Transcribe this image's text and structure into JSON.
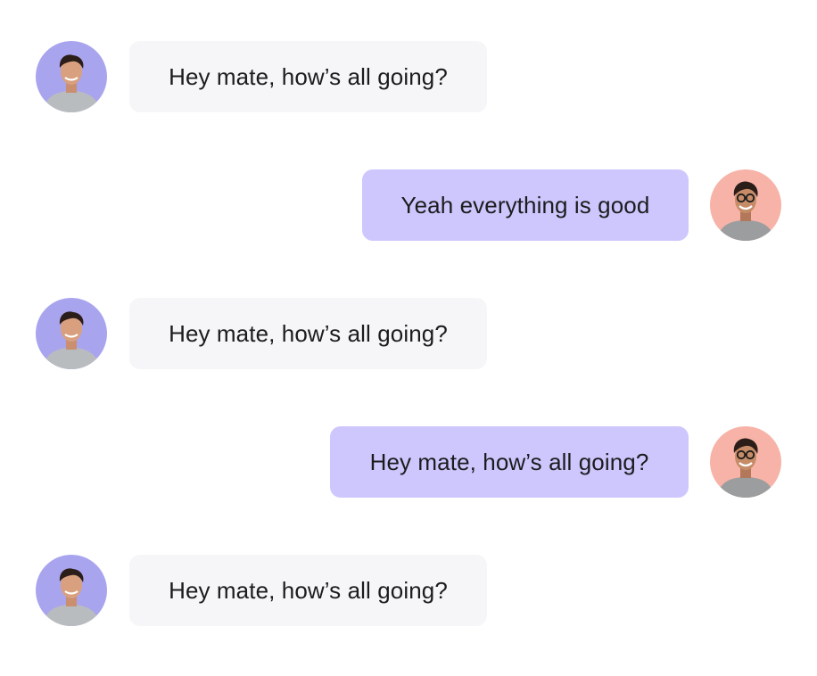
{
  "messages": [
    {
      "direction": "incoming",
      "text": "Hey mate, how’s all going?",
      "avatar": "avatar-man-purple-bg"
    },
    {
      "direction": "outgoing",
      "text": "Yeah everything is good",
      "avatar": "avatar-man-glasses-peach-bg"
    },
    {
      "direction": "incoming",
      "text": "Hey mate, how’s all going?",
      "avatar": "avatar-man-purple-bg"
    },
    {
      "direction": "outgoing",
      "text": "Hey mate, how’s all going?",
      "avatar": "avatar-man-glasses-peach-bg"
    },
    {
      "direction": "incoming",
      "text": "Hey mate, how’s all going?",
      "avatar": "avatar-man-purple-bg"
    }
  ],
  "colors": {
    "incoming_bubble": "#f6f6f8",
    "outgoing_bubble": "#cdc7fd",
    "incoming_avatar_bg": "#a9a4ee",
    "outgoing_avatar_bg": "#f7b3a7",
    "text": "#1c1c1e"
  }
}
